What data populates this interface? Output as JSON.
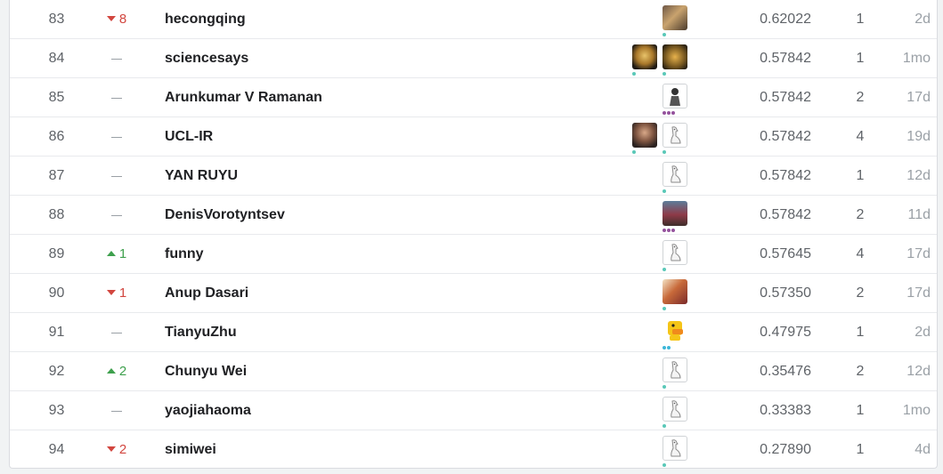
{
  "leaderboard": {
    "rows": [
      {
        "rank": "83",
        "change_dir": "down",
        "change": "8",
        "team": "hecongqing",
        "avatars": [
          {
            "style": "photo-a",
            "tier": "novice"
          }
        ],
        "score": "0.62022",
        "entries": "1",
        "last": "2d"
      },
      {
        "rank": "84",
        "change_dir": "none",
        "change": "",
        "team": "sciencesays",
        "avatars": [
          {
            "style": "photo-b",
            "tier": "novice"
          },
          {
            "style": "photo-c",
            "tier": "novice"
          }
        ],
        "score": "0.57842",
        "entries": "1",
        "last": "1mo"
      },
      {
        "rank": "85",
        "change_dir": "none",
        "change": "",
        "team": "Arunkumar V Ramanan",
        "avatars": [
          {
            "style": "photo-d",
            "tier": "expert"
          }
        ],
        "score": "0.57842",
        "entries": "2",
        "last": "17d"
      },
      {
        "rank": "86",
        "change_dir": "none",
        "change": "",
        "team": "UCL-IR",
        "avatars": [
          {
            "style": "photo-e",
            "tier": "novice"
          },
          {
            "style": "default",
            "tier": "novice"
          }
        ],
        "score": "0.57842",
        "entries": "4",
        "last": "19d"
      },
      {
        "rank": "87",
        "change_dir": "none",
        "change": "",
        "team": "YAN RUYU",
        "avatars": [
          {
            "style": "default",
            "tier": "novice"
          }
        ],
        "score": "0.57842",
        "entries": "1",
        "last": "12d"
      },
      {
        "rank": "88",
        "change_dir": "none",
        "change": "",
        "team": "DenisVorotyntsev",
        "avatars": [
          {
            "style": "photo-f",
            "tier": "expert"
          }
        ],
        "score": "0.57842",
        "entries": "2",
        "last": "11d"
      },
      {
        "rank": "89",
        "change_dir": "up",
        "change": "1",
        "team": "funny",
        "avatars": [
          {
            "style": "default",
            "tier": "novice"
          }
        ],
        "score": "0.57645",
        "entries": "4",
        "last": "17d"
      },
      {
        "rank": "90",
        "change_dir": "down",
        "change": "1",
        "team": "Anup Dasari",
        "avatars": [
          {
            "style": "photo-g",
            "tier": "novice"
          }
        ],
        "score": "0.57350",
        "entries": "2",
        "last": "17d"
      },
      {
        "rank": "91",
        "change_dir": "none",
        "change": "",
        "team": "TianyuZhu",
        "avatars": [
          {
            "style": "duck",
            "tier": "contributor"
          }
        ],
        "score": "0.47975",
        "entries": "1",
        "last": "2d"
      },
      {
        "rank": "92",
        "change_dir": "up",
        "change": "2",
        "team": "Chunyu Wei",
        "avatars": [
          {
            "style": "default",
            "tier": "novice"
          }
        ],
        "score": "0.35476",
        "entries": "2",
        "last": "12d"
      },
      {
        "rank": "93",
        "change_dir": "none",
        "change": "",
        "team": "yaojiahaoma",
        "avatars": [
          {
            "style": "default",
            "tier": "novice"
          }
        ],
        "score": "0.33383",
        "entries": "1",
        "last": "1mo"
      },
      {
        "rank": "94",
        "change_dir": "down",
        "change": "2",
        "team": "simiwei",
        "avatars": [
          {
            "style": "default",
            "tier": "novice"
          }
        ],
        "score": "0.27890",
        "entries": "1",
        "last": "4d"
      }
    ]
  },
  "colors": {
    "up": "#3ea04d",
    "down": "#d2463f",
    "tier_novice": "#5ac8b8",
    "tier_contributor": "#3cb7d9",
    "tier_expert": "#95529d"
  },
  "icons": {
    "change_up": "triangle-up-icon",
    "change_down": "triangle-down-icon",
    "change_none": "dash-icon",
    "default_avatar": "goose-avatar-icon",
    "duck_avatar": "duck-avatar-icon"
  }
}
